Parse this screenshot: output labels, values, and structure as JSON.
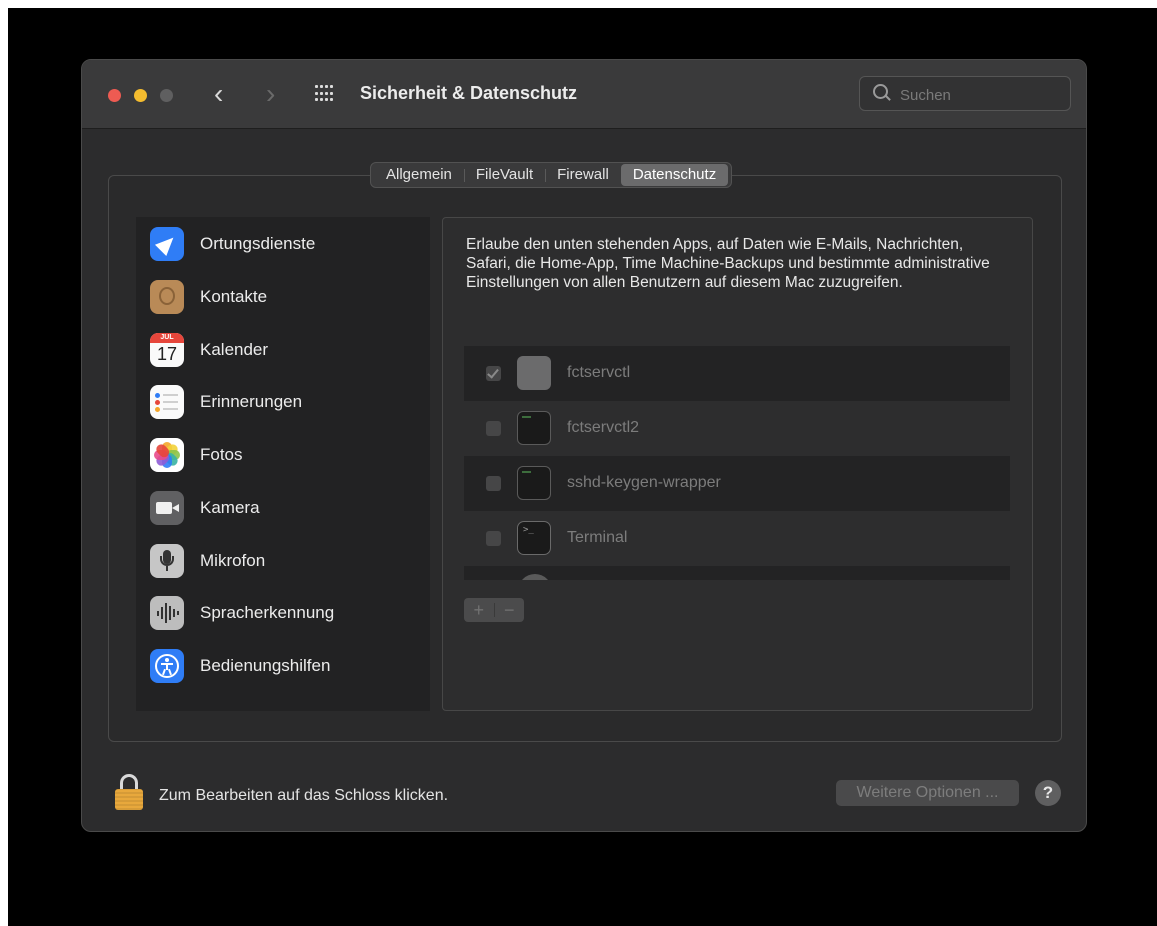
{
  "window": {
    "title": "Sicherheit & Datenschutz",
    "search_placeholder": "Suchen"
  },
  "tabs": [
    {
      "label": "Allgemein",
      "active": false
    },
    {
      "label": "FileVault",
      "active": false
    },
    {
      "label": "Firewall",
      "active": false
    },
    {
      "label": "Datenschutz",
      "active": true
    }
  ],
  "sidebar": {
    "items": [
      {
        "label": "Ortungsdienste",
        "icon": "location-arrow-icon"
      },
      {
        "label": "Kontakte",
        "icon": "contacts-icon"
      },
      {
        "label": "Kalender",
        "icon": "calendar-icon",
        "month": "JUL",
        "day": "17"
      },
      {
        "label": "Erinnerungen",
        "icon": "reminders-icon"
      },
      {
        "label": "Fotos",
        "icon": "photos-icon"
      },
      {
        "label": "Kamera",
        "icon": "camera-icon"
      },
      {
        "label": "Mikrofon",
        "icon": "microphone-icon"
      },
      {
        "label": "Spracherkennung",
        "icon": "speech-recognition-icon"
      },
      {
        "label": "Bedienungshilfen",
        "icon": "accessibility-icon"
      }
    ]
  },
  "content": {
    "description": "Erlaube den unten stehenden Apps, auf Daten wie E-Mails, Nachrichten, Safari, die Home-App, Time Machine-Backups und bestimmte administrative Einstellungen von allen Benutzern auf diesem Mac zuzugreifen.",
    "apps": [
      {
        "name": "fctservctl",
        "checked": true,
        "icon": "blank-app-icon"
      },
      {
        "name": "fctservctl2",
        "checked": false,
        "icon": "executable-icon"
      },
      {
        "name": "sshd-keygen-wrapper",
        "checked": false,
        "icon": "executable-icon"
      },
      {
        "name": "Terminal",
        "checked": false,
        "icon": "terminal-icon"
      }
    ],
    "add_label": "+",
    "remove_label": "−"
  },
  "footer": {
    "lock_text": "Zum Bearbeiten auf das Schloss klicken.",
    "more_options_label": "Weitere Optionen ...",
    "help_label": "?"
  },
  "colors": {
    "window_bg": "#2c2c2d",
    "accent_blue": "#2f7df6",
    "lock_gold": "#e8a83c"
  }
}
